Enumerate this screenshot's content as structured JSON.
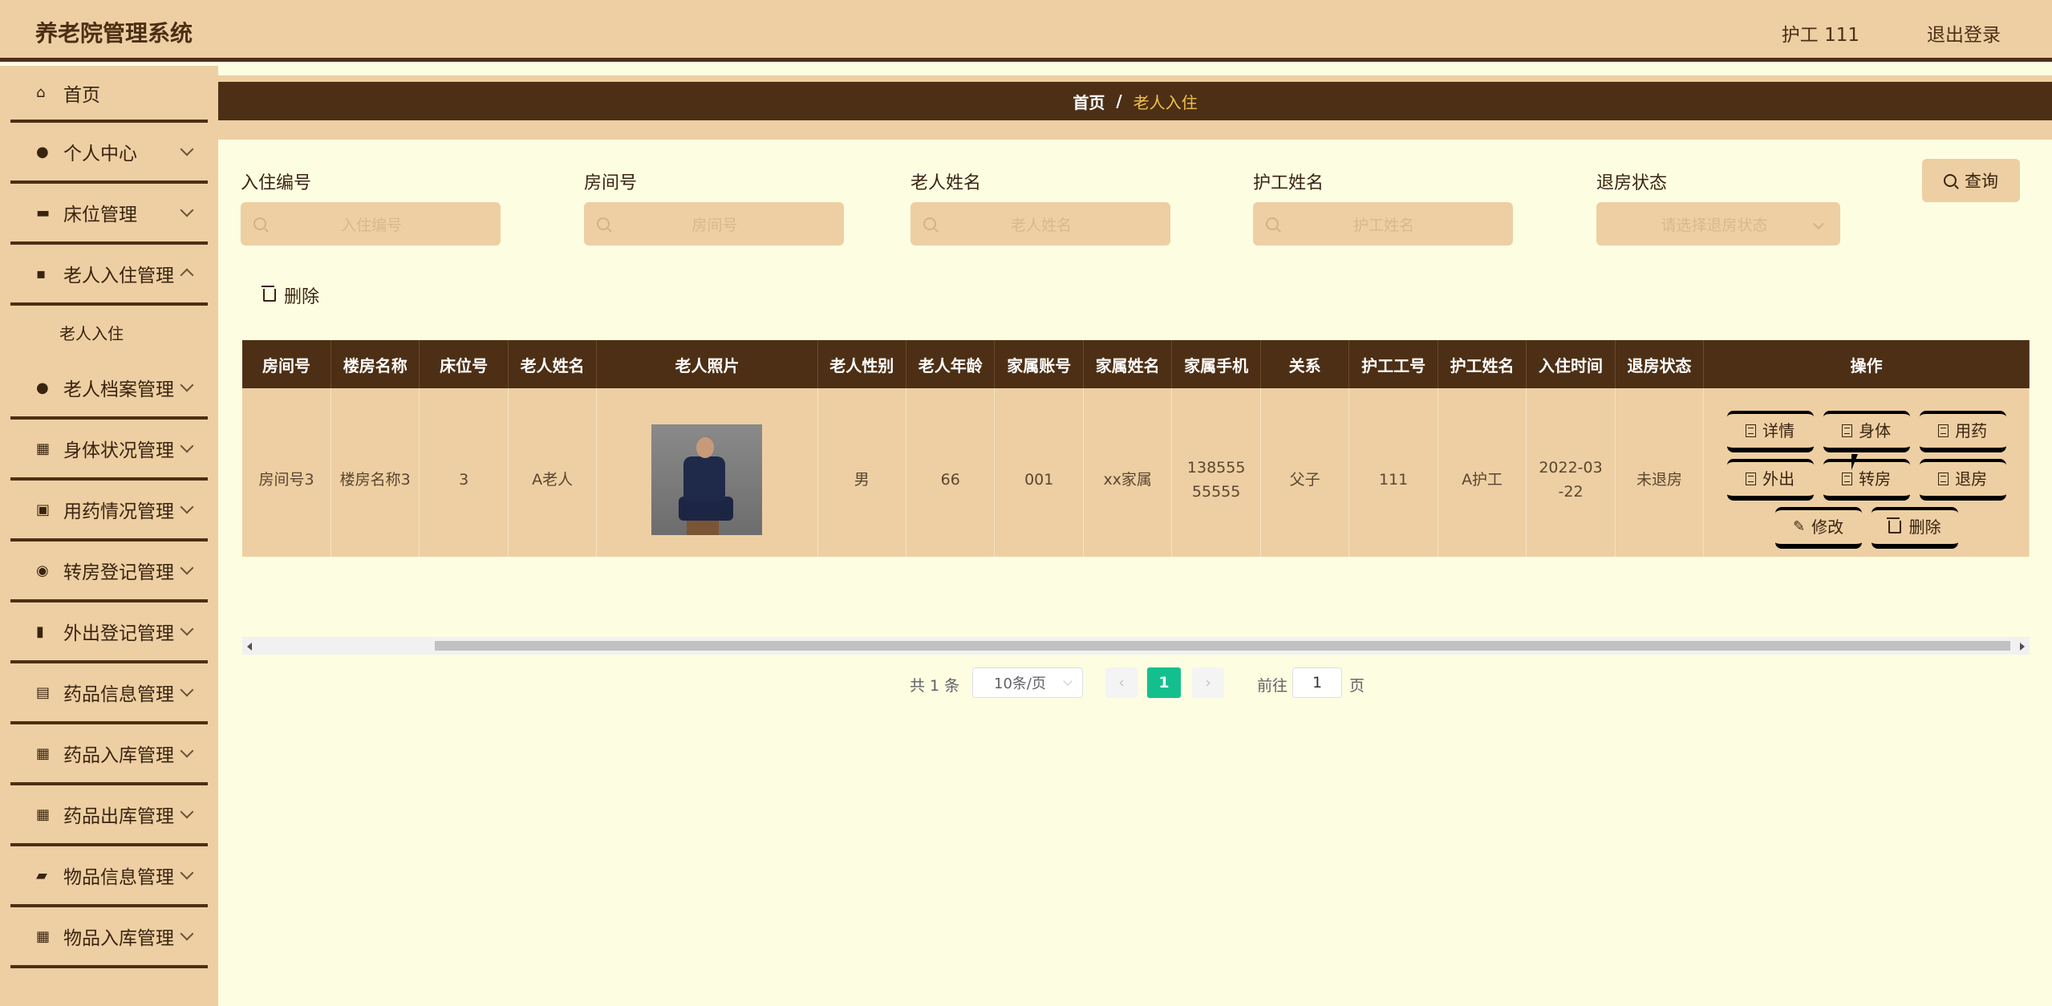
{
  "header": {
    "title": "养老院管理系统",
    "user": "护工 111",
    "logout": "退出登录"
  },
  "sidebar": {
    "items": [
      {
        "label": "首页",
        "icon": "home-icon",
        "glyph": "⌂"
      },
      {
        "label": "个人中心",
        "icon": "user-icon",
        "glyph": "●"
      },
      {
        "label": "床位管理",
        "icon": "bed-icon",
        "glyph": "▬"
      },
      {
        "label": "老人入住管理",
        "icon": "chat-icon",
        "glyph": "▪"
      },
      {
        "sub": "老人入住"
      },
      {
        "label": "老人档案管理",
        "icon": "user-icon",
        "glyph": "●"
      },
      {
        "label": "身体状况管理",
        "icon": "grid-icon",
        "glyph": "▦"
      },
      {
        "label": "用药情况管理",
        "icon": "clipboard-icon",
        "glyph": "▣"
      },
      {
        "label": "转房登记管理",
        "icon": "location-icon",
        "glyph": "◉"
      },
      {
        "label": "外出登记管理",
        "icon": "bar-chart-icon",
        "glyph": "▮"
      },
      {
        "label": "药品信息管理",
        "icon": "line-chart-icon",
        "glyph": "▤"
      },
      {
        "label": "药品入库管理",
        "icon": "grid-icon",
        "glyph": "▦"
      },
      {
        "label": "药品出库管理",
        "icon": "grid-icon",
        "glyph": "▦"
      },
      {
        "label": "物品信息管理",
        "icon": "wallet-icon",
        "glyph": "▰"
      },
      {
        "label": "物品入库管理",
        "icon": "grid-icon",
        "glyph": "▦"
      }
    ]
  },
  "breadcrumb": {
    "home": "首页",
    "sep": "/",
    "current": "老人入住"
  },
  "search": {
    "fields": [
      {
        "label": "入住编号",
        "placeholder": "入住编号"
      },
      {
        "label": "房间号",
        "placeholder": "房间号"
      },
      {
        "label": "老人姓名",
        "placeholder": "老人姓名"
      },
      {
        "label": "护工姓名",
        "placeholder": "护工姓名"
      },
      {
        "label": "退房状态",
        "placeholder": "请选择退房状态"
      }
    ],
    "query_label": "查询"
  },
  "toolbar": {
    "delete_label": "删除"
  },
  "table": {
    "headers": [
      "房间号",
      "楼房名称",
      "床位号",
      "老人姓名",
      "老人照片",
      "老人性别",
      "老人年龄",
      "家属账号",
      "家属姓名",
      "家属手机",
      "关系",
      "护工工号",
      "护工姓名",
      "入住时间",
      "退房状态",
      "操作"
    ],
    "rows": [
      {
        "room": "房间号3",
        "building": "楼房名称3",
        "bed": "3",
        "name": "A老人",
        "gender": "男",
        "age": "66",
        "family_account": "001",
        "family_name": "xx家属",
        "family_phone": "13855555555",
        "relation": "父子",
        "nurse_id": "111",
        "nurse_name": "A护工",
        "checkin_time": "2022-03-22",
        "checkout_status": "未退房"
      }
    ],
    "actions": [
      "详情",
      "身体",
      "用药",
      "外出",
      "转房",
      "退房",
      "修改",
      "删除"
    ]
  },
  "pagination": {
    "total": "共 1 条",
    "page_size": "10条/页",
    "current": "1",
    "goto": "前往",
    "goto_value": "1",
    "unit": "页"
  },
  "colors": {
    "accent": "#4d2f15",
    "panel": "#edcfa3",
    "background": "#fdfde1",
    "page_active": "#13c08d",
    "breadcrumb_current": "#f0c24d"
  }
}
